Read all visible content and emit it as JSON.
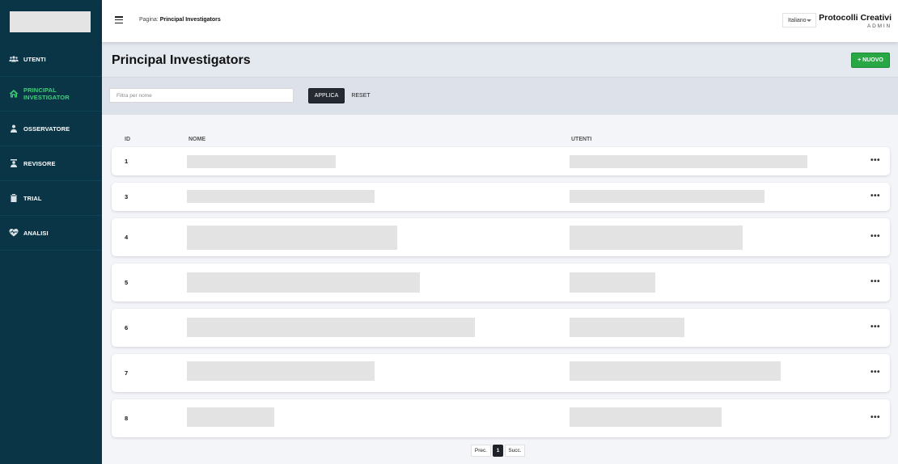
{
  "sidebar": {
    "items": [
      {
        "label": "UTENTI",
        "icon": "users-icon",
        "active": false
      },
      {
        "label": "PRINCIPAL INVESTIGATOR",
        "icon": "home-icon",
        "active": true
      },
      {
        "label": "OSSERVATORE",
        "icon": "person-icon",
        "active": false
      },
      {
        "label": "REVISORE",
        "icon": "reviewer-icon",
        "active": false
      },
      {
        "label": "TRIAL",
        "icon": "clipboard-icon",
        "active": false
      },
      {
        "label": "ANALISI",
        "icon": "heartbeat-icon",
        "active": false
      }
    ]
  },
  "header": {
    "breadcrumb_prefix": "Pagina:",
    "breadcrumb_page": "Principal Investigators",
    "language": "Italiano",
    "brand_title": "Protocolli Creativi",
    "brand_subtitle": "ADMIN"
  },
  "main": {
    "title": "Principal Investigators",
    "new_button": "+ NUOVO"
  },
  "filter": {
    "placeholder": "Filtra per nome",
    "apply_label": "APPLICA",
    "reset_label": "RESET"
  },
  "table": {
    "columns": [
      "ID",
      "NOME",
      "UTENTI"
    ],
    "rows": [
      {
        "id": "1",
        "more": "•••"
      },
      {
        "id": "3",
        "more": "•••"
      },
      {
        "id": "4",
        "more": "•••"
      },
      {
        "id": "5",
        "more": "•••"
      },
      {
        "id": "6",
        "more": "•••"
      },
      {
        "id": "7",
        "more": "•••"
      },
      {
        "id": "8",
        "more": "•••"
      }
    ]
  },
  "pagination": {
    "prev": "Prec.",
    "current": "1",
    "next": "Succ."
  },
  "colors": {
    "sidebar_bg": "#0a3547",
    "active_accent": "#3fd07a",
    "primary_button": "#28a745",
    "dark_button": "#262a33"
  }
}
